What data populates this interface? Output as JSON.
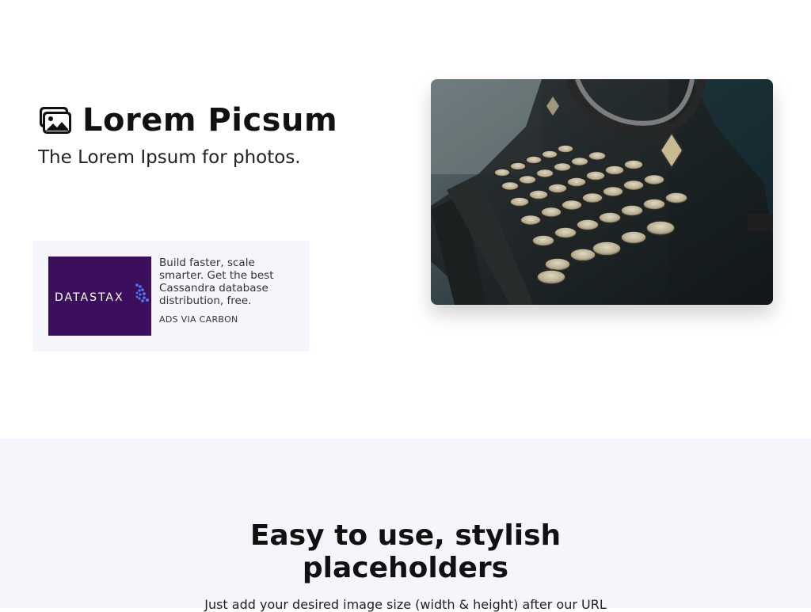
{
  "brand": {
    "title": "Lorem Picsum",
    "icon": "photos-icon",
    "tagline": "The Lorem Ipsum for photos."
  },
  "ad": {
    "logo_text": "DATASTAX",
    "text": "Build faster, scale smarter. Get the best Cassandra database distribution, free.",
    "via": "ADS VIA CARBON",
    "colors": {
      "logo_bg": "#3b0f5c",
      "dots": "#3d6cf0"
    }
  },
  "hero_image": {
    "subject": "vintage typewriter"
  },
  "features": {
    "title_line1": "Easy to use, stylish",
    "title_line2": "placeholders",
    "subtitle": "Just add your desired image size (width & height) after our URL"
  },
  "colors": {
    "section_bg": "#f4f6fb",
    "text": "#111111"
  }
}
